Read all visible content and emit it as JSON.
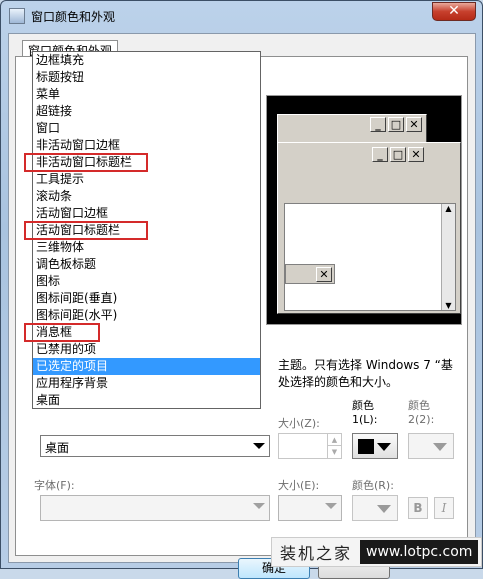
{
  "window": {
    "title": "窗口颜色和外观",
    "close_glyph": "✕"
  },
  "tab": {
    "label": "窗口颜色和外观"
  },
  "preview": {
    "min_glyph": "_",
    "max_glyph": "□",
    "close_glyph": "✕",
    "up_glyph": "▲",
    "down_glyph": "▼"
  },
  "description": {
    "line1": "主题。只有选择 Windows 7 “基",
    "line2": "处选择的颜色和大小。"
  },
  "item_dropdown": {
    "selected": "桌面",
    "options": [
      "边框填充",
      "标题按钮",
      "菜单",
      "超链接",
      "窗口",
      "非活动窗口边框",
      "非活动窗口标题栏",
      "工具提示",
      "滚动条",
      "活动窗口边框",
      "活动窗口标题栏",
      "三维物体",
      "调色板标题",
      "图标",
      "图标间距(垂直)",
      "图标间距(水平)",
      "消息框",
      "已禁用的项",
      "已选定的项目",
      "应用程序背景",
      "桌面"
    ],
    "highlighted_index": 18,
    "marked_indices": [
      6,
      10,
      16
    ]
  },
  "size1": {
    "label": "大小(Z):"
  },
  "color1": {
    "label_line1": "颜色",
    "label_line2": "1(L):",
    "swatch": "#000000"
  },
  "color2": {
    "label_line1": "颜色",
    "label_line2": "2(2):"
  },
  "font": {
    "label": "字体(F):"
  },
  "size2": {
    "label": "大小(E):"
  },
  "color3": {
    "label": "颜色(R):"
  },
  "format": {
    "bold": "B",
    "italic": "I"
  },
  "buttons": {
    "ok": "确定"
  },
  "watermark": {
    "left": "装机之家",
    "right": "www.lotpc.com"
  },
  "colors": {
    "highlight": "#3399ff",
    "marker": "#d42a2a"
  }
}
